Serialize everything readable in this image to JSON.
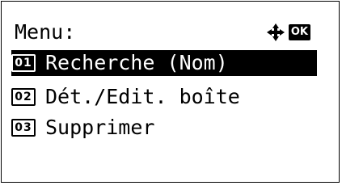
{
  "screen": {
    "title": "Menu:",
    "ok_label": "OK"
  },
  "menu": {
    "items": [
      {
        "number": "01",
        "label": "Recherche (Nom)",
        "selected": true
      },
      {
        "number": "02",
        "label": "Dét./Edit. boîte",
        "selected": false
      },
      {
        "number": "03",
        "label": "Supprimer",
        "selected": false
      }
    ]
  },
  "colors": {
    "foreground": "#000000",
    "background": "#ffffff"
  },
  "icons": {
    "navigation": "four-way-arrow-icon",
    "confirm": "ok-key-icon"
  }
}
